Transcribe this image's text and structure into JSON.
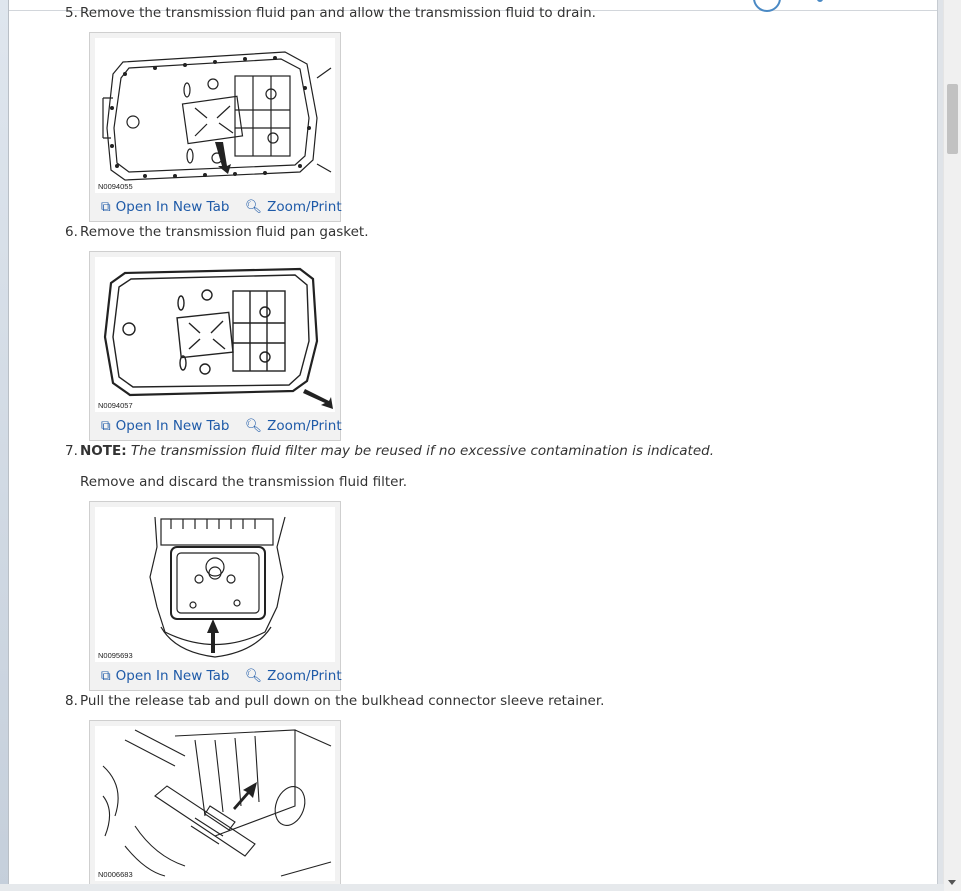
{
  "steps": [
    {
      "num": "5.",
      "text": "Remove the transmission fluid pan and allow the transmission fluid to drain."
    },
    {
      "num": "6.",
      "text": "Remove the transmission fluid pan gasket."
    },
    {
      "num": "7.",
      "note_label": "NOTE:",
      "note_text": "The transmission fluid filter may be reused if no excessive contamination is indicated.",
      "text": "Remove and discard the transmission fluid filter."
    },
    {
      "num": "8.",
      "text": "Pull the release tab and pull down on the bulkhead connector sleeve retainer."
    }
  ],
  "figures": [
    {
      "code": "N0094055",
      "open_label": "Open In New Tab",
      "zoom_label": "Zoom/Print"
    },
    {
      "code": "N0094057",
      "open_label": "Open In New Tab",
      "zoom_label": "Zoom/Print"
    },
    {
      "code": "N0095693",
      "open_label": "Open In New Tab",
      "zoom_label": "Zoom/Print"
    },
    {
      "code": "N0006683"
    }
  ],
  "icons": {
    "open": "open-new-tab-icon",
    "zoom": "magnifier-zoom-icon"
  },
  "colors": {
    "link": "#1e5aa8",
    "text": "#333333",
    "panel": "#f2f2f2"
  }
}
